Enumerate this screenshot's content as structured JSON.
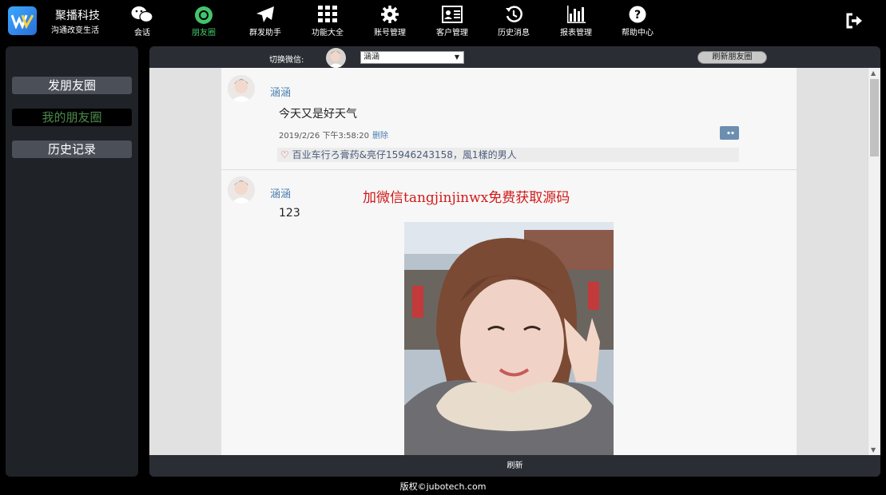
{
  "brand": {
    "name": "聚播科技",
    "slogan": "沟通改变生活"
  },
  "nav": [
    {
      "label": "会话",
      "icon": "wechat-icon"
    },
    {
      "label": "朋友圈",
      "icon": "moments-icon",
      "active": true
    },
    {
      "label": "群发助手",
      "icon": "paper-plane-icon"
    },
    {
      "label": "功能大全",
      "icon": "grid-icon"
    },
    {
      "label": "账号管理",
      "icon": "gear-icon"
    },
    {
      "label": "客户管理",
      "icon": "contact-card-icon"
    },
    {
      "label": "历史消息",
      "icon": "history-icon"
    },
    {
      "label": "报表管理",
      "icon": "bar-chart-icon"
    },
    {
      "label": "帮助中心",
      "icon": "help-icon"
    }
  ],
  "sidebar": {
    "items": [
      {
        "label": "发朋友圈",
        "active": false
      },
      {
        "label": "我的朋友圈",
        "active": true
      },
      {
        "label": "历史记录",
        "active": false
      }
    ]
  },
  "toolbar": {
    "switch_label": "切换微信:",
    "selected_account": "涵涵",
    "refresh_label": "刷新朋友圈"
  },
  "posts": [
    {
      "user": "涵涵",
      "text": "今天又是好天气",
      "timestamp": "2019/2/26 下午3:58:20",
      "delete_label": "删除",
      "likes_text": "百业车行ろ膏药&亮仔15946243158，風1樣的男人"
    },
    {
      "user": "涵涵",
      "text": "123"
    }
  ],
  "watermark": "加微信tangjinjinwx免费获取源码",
  "bottom_refresh": "刷新",
  "footer": "版权©jubotech.com",
  "colors": {
    "accent_active": "#43c56b",
    "link": "#4a7fb0",
    "watermark": "#d11a1a"
  }
}
